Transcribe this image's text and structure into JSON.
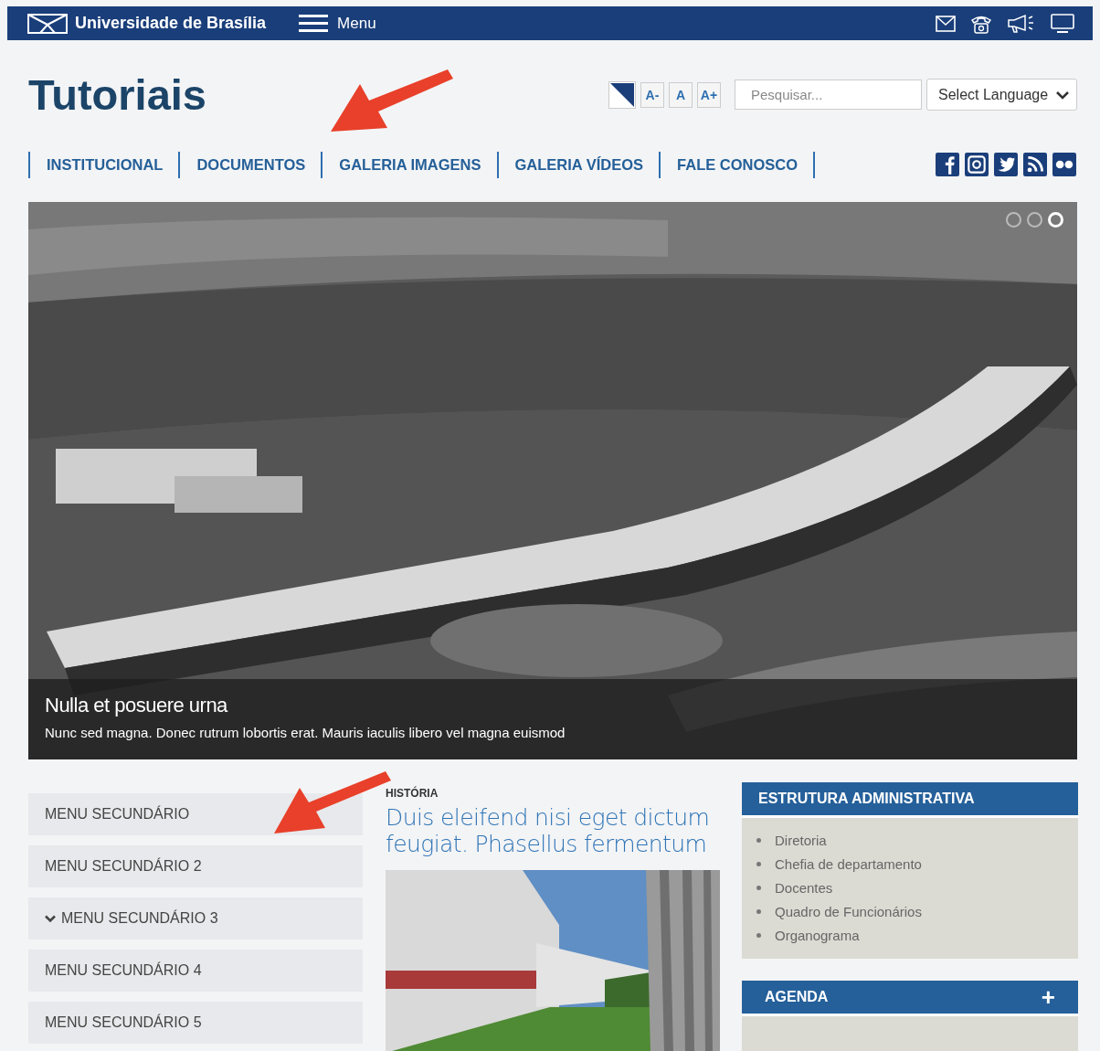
{
  "top_bar": {
    "brand": "Universidade de Brasília",
    "menu_label": "Menu"
  },
  "header": {
    "title": "Tutoriais",
    "font_buttons": [
      "A-",
      "A",
      "A+"
    ],
    "search": {
      "placeholder": "Pesquisar..."
    },
    "language_select": {
      "value": "Select Language"
    }
  },
  "nav": [
    "INSTITUCIONAL",
    "DOCUMENTOS",
    "GALERIA IMAGENS",
    "GALERIA VÍDEOS",
    "FALE CONOSCO"
  ],
  "slider": {
    "dots": [
      {
        "selected": false
      },
      {
        "selected": false
      },
      {
        "selected": true
      }
    ],
    "caption_title": "Nulla et posuere urna",
    "caption_text": "Nunc sed magna. Donec rutrum lobortis erat. Mauris iaculis libero vel magna euismod"
  },
  "secondary_menu": [
    {
      "label": "MENU SECUNDÁRIO",
      "expanded": false
    },
    {
      "label": "MENU SECUNDÁRIO 2",
      "expanded": false
    },
    {
      "label": "MENU SECUNDÁRIO 3",
      "expanded": true
    },
    {
      "label": "MENU SECUNDÁRIO 4",
      "expanded": false
    },
    {
      "label": "MENU SECUNDÁRIO 5",
      "expanded": false
    }
  ],
  "article": {
    "category": "HISTÓRIA",
    "title": "Duis eleifend nisi eget dictum feugiat. Phasellus fermentum"
  },
  "structure_panel": {
    "title": "ESTRUTURA ADMINISTRATIVA",
    "items": [
      "Diretoria",
      "Chefia de departamento",
      "Docentes",
      "Quadro de Funcionários",
      "Organograma"
    ]
  },
  "agenda_panel": {
    "title": "AGENDA",
    "add_symbol": "+"
  }
}
